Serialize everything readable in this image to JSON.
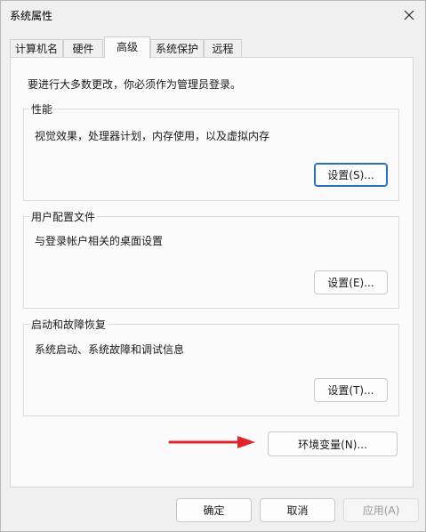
{
  "window": {
    "title": "系统属性"
  },
  "tabs": [
    {
      "label": "计算机名"
    },
    {
      "label": "硬件"
    },
    {
      "label": "高级"
    },
    {
      "label": "系统保护"
    },
    {
      "label": "远程"
    }
  ],
  "advanced": {
    "intro": "要进行大多数更改，你必须作为管理员登录。",
    "performance": {
      "title": "性能",
      "description": "视觉效果，处理器计划，内存使用，以及虚拟内存",
      "button": "设置(S)..."
    },
    "user_profiles": {
      "title": "用户配置文件",
      "description": "与登录帐户相关的桌面设置",
      "button": "设置(E)..."
    },
    "startup_recovery": {
      "title": "启动和故障恢复",
      "description": "系统启动、系统故障和调试信息",
      "button": "设置(T)..."
    },
    "env_button": "环境变量(N)..."
  },
  "footer": {
    "ok": "确定",
    "cancel": "取消",
    "apply": "应用(A)"
  },
  "colors": {
    "accent": "#2a6ebd",
    "arrow": "#e0242b"
  }
}
